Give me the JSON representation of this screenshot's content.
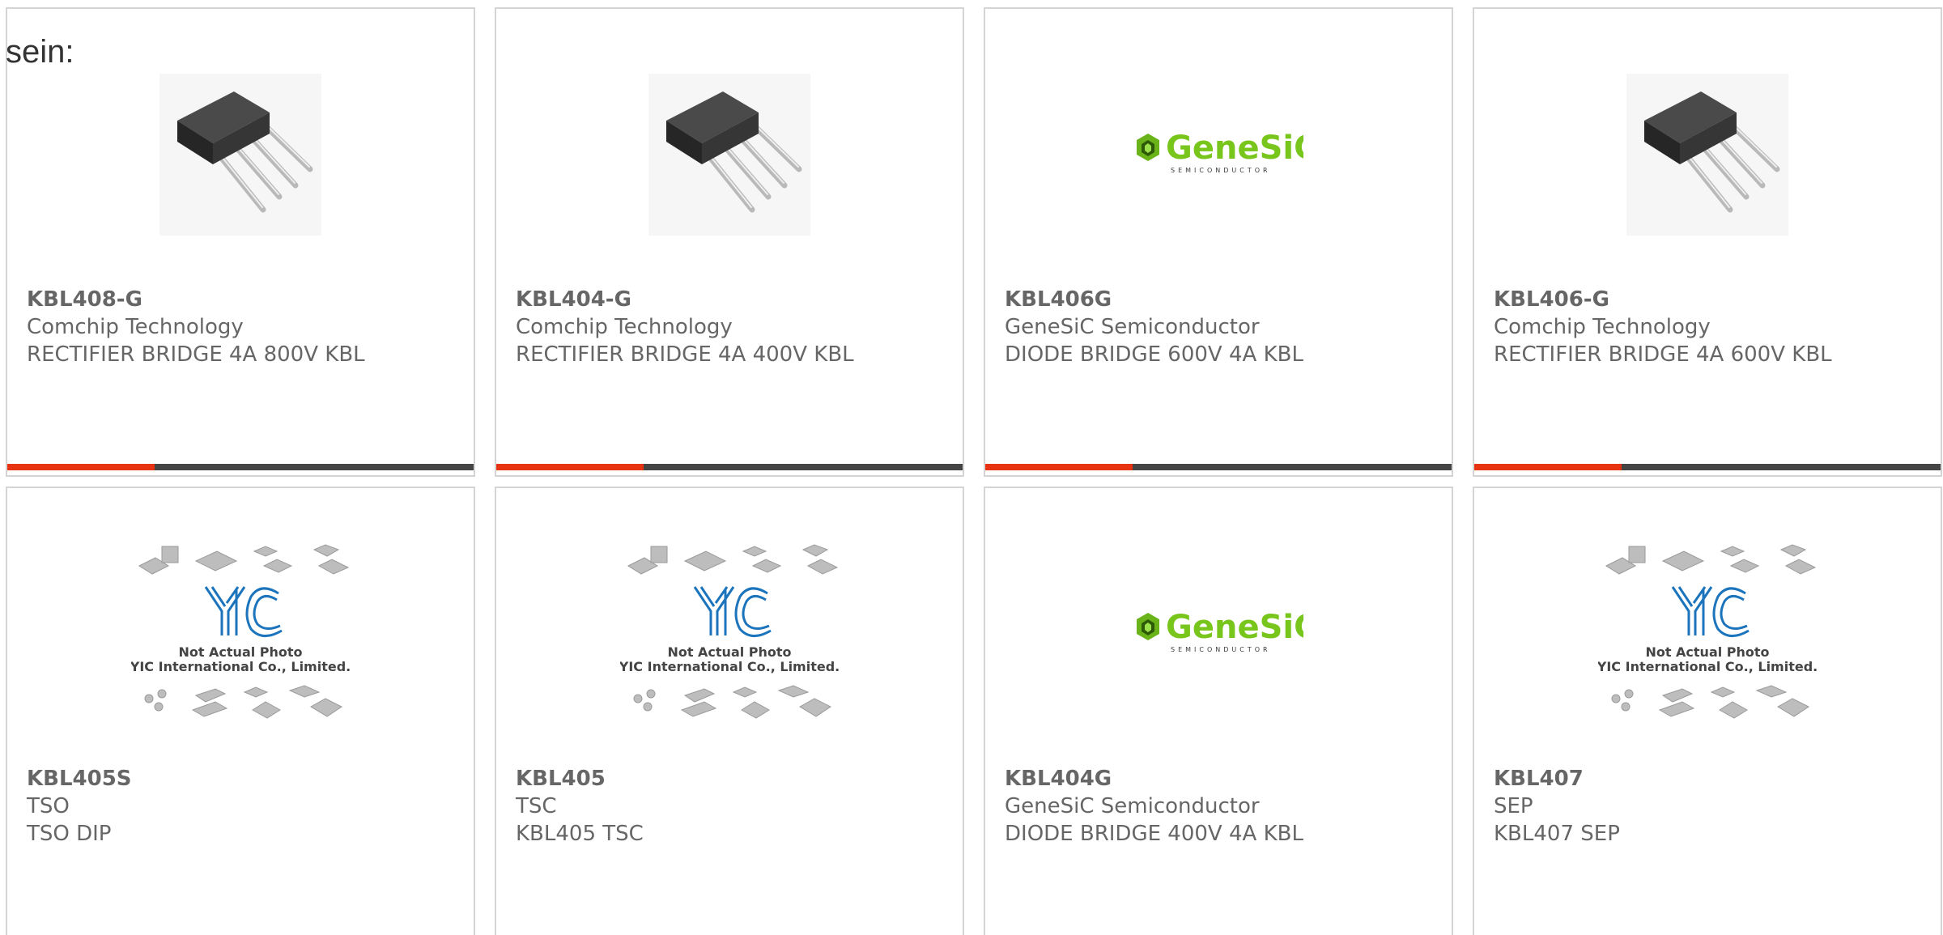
{
  "intro_text": "sein:",
  "colors": {
    "accent": "#e63312",
    "bar": "#444444",
    "text": "#666666",
    "border": "#d4d4d4"
  },
  "products": [
    {
      "part": "KBL408-G",
      "manufacturer": "Comchip Technology",
      "description": "RECTIFIER BRIDGE 4A 800V KBL",
      "image": "bridge-rectifier-photo",
      "has_bar": true
    },
    {
      "part": "KBL404-G",
      "manufacturer": "Comchip Technology",
      "description": "RECTIFIER BRIDGE 4A 400V KBL",
      "image": "bridge-rectifier-photo",
      "has_bar": true
    },
    {
      "part": "KBL406G",
      "manufacturer": "GeneSiC Semiconductor",
      "description": "DIODE BRIDGE 600V 4A KBL",
      "image": "genesic-logo",
      "has_bar": true
    },
    {
      "part": "KBL406-G",
      "manufacturer": "Comchip Technology",
      "description": "RECTIFIER BRIDGE 4A 600V KBL",
      "image": "bridge-rectifier-photo",
      "has_bar": true
    },
    {
      "part": "KBL405S",
      "manufacturer": "TSO",
      "description": "TSO DIP",
      "image": "yic-placeholder",
      "has_bar": false
    },
    {
      "part": "KBL405",
      "manufacturer": "TSC",
      "description": "KBL405 TSC",
      "image": "yic-placeholder",
      "has_bar": false
    },
    {
      "part": "KBL404G",
      "manufacturer": "GeneSiC Semiconductor",
      "description": "DIODE BRIDGE 400V 4A KBL",
      "image": "genesic-logo",
      "has_bar": false
    },
    {
      "part": "KBL407",
      "manufacturer": "SEP",
      "description": "KBL407 SEP",
      "image": "yic-placeholder",
      "has_bar": false
    }
  ],
  "yic_placeholder": {
    "line1": "Not Actual Photo",
    "line2": "YIC International Co., Limited."
  },
  "genesic_logo": {
    "word": "GeneSiC",
    "sub": "SEMICONDUCTOR"
  }
}
